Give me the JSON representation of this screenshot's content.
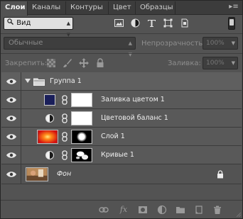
{
  "tabs": [
    {
      "label": "Слои",
      "active": true
    },
    {
      "label": "Каналы",
      "active": false
    },
    {
      "label": "Контуры",
      "active": false
    },
    {
      "label": "Цвет",
      "active": false
    },
    {
      "label": "Образцы",
      "active": false
    }
  ],
  "filter": {
    "label": "Вид",
    "icons": [
      "image-filter-icon",
      "adjustment-filter-icon",
      "type-filter-icon",
      "shape-filter-icon",
      "smart-object-filter-icon"
    ]
  },
  "blend": {
    "mode": "Обычные",
    "opacity_label": "Непрозрачность:",
    "opacity_value": "100%"
  },
  "lock": {
    "label": "Закрепить:",
    "fill_label": "Заливка:",
    "fill_value": "100%"
  },
  "layers": [
    {
      "name": "Группа 1",
      "kind": "group",
      "expanded": true
    },
    {
      "name": "Заливка цветом 1",
      "kind": "solid-fill",
      "color": "#1a1f5a"
    },
    {
      "name": "Цветовой баланс 1",
      "kind": "adjustment"
    },
    {
      "name": "Слой 1",
      "kind": "pixel"
    },
    {
      "name": "Кривые 1",
      "kind": "adjustment"
    },
    {
      "name": "Фон",
      "kind": "background",
      "locked": true
    }
  ],
  "bottom_icons": [
    "link-layers-icon",
    "fx-icon",
    "add-mask-icon",
    "new-adjustment-icon",
    "new-group-icon",
    "new-layer-icon",
    "delete-layer-icon"
  ],
  "colors": {
    "panel": "#535353",
    "tabbar": "#3c3c3c",
    "text": "#f0f0f0"
  }
}
